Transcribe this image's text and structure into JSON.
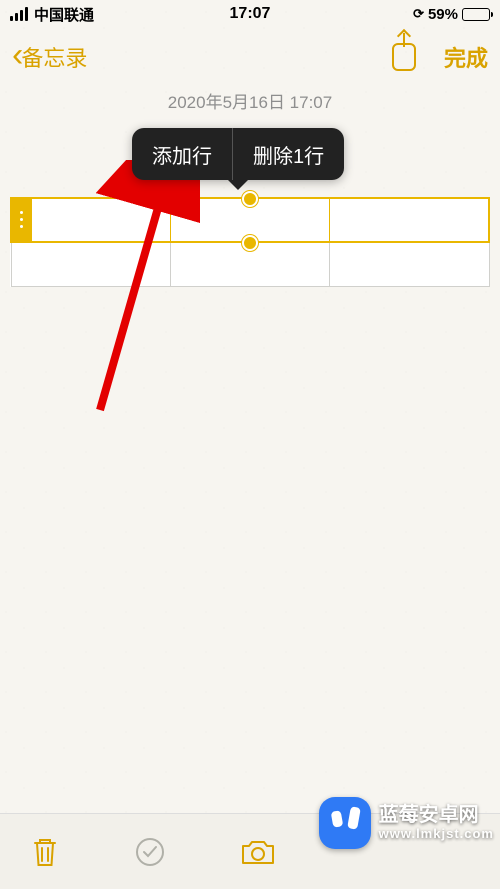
{
  "status": {
    "carrier": "中国联通",
    "time": "17:07",
    "battery_pct": "59%"
  },
  "nav": {
    "back_label": "备忘录",
    "done_label": "完成"
  },
  "note": {
    "timestamp": "2020年5月16日 17:07"
  },
  "context_menu": {
    "add_row": "添加行",
    "delete_row": "删除1行"
  },
  "overlay": {
    "title": "蓝莓安卓网",
    "url": "www.lmkjst.com"
  },
  "colors": {
    "accent": "#d9a200",
    "selection": "#e9b700",
    "android_blue": "#2f7af5"
  }
}
